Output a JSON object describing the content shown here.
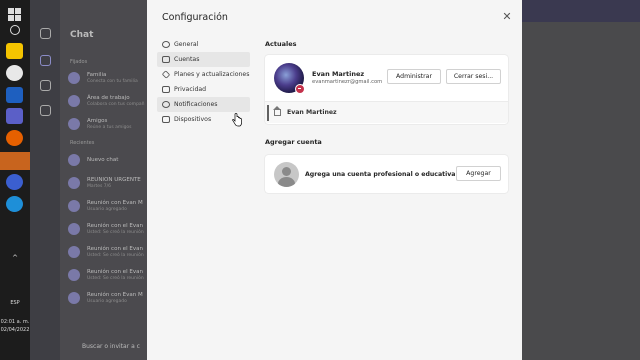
{
  "taskbar": {
    "icons": [
      {
        "name": "windows-start-icon"
      },
      {
        "name": "search-icon"
      },
      {
        "name": "sticky-notes-icon",
        "color": "#f5c400"
      },
      {
        "name": "paint-icon",
        "color": "#e8e8e8"
      },
      {
        "name": "mail-icon",
        "color": "#1e5fbf"
      },
      {
        "name": "teams-icon",
        "color": "#5b5fc7"
      },
      {
        "name": "firefox-icon",
        "color": "#e66000"
      },
      {
        "name": "chrome-icon",
        "color": "#ea4335"
      },
      {
        "name": "app-icon",
        "color": "#c8641e"
      },
      {
        "name": "chromium-icon",
        "color": "#3b5fd0"
      },
      {
        "name": "edge-icon",
        "color": "#1e8fd8"
      }
    ],
    "language": "ESP",
    "time": "02:01 a. m.",
    "date": "02/04/2022"
  },
  "background": {
    "chat_title": "Chat",
    "pinned_label": "Fijados",
    "recent_label": "Recientes",
    "rows": [
      {
        "name": "Familia",
        "sub": "Conecta con tu familia"
      },
      {
        "name": "Área de trabajo",
        "sub": "Colabora con tus compañ"
      },
      {
        "name": "Amigos",
        "sub": "Reúne a tus amigos"
      },
      {
        "name": "Nuevo chat",
        "sub": ""
      },
      {
        "name": "REUNION URGENTE",
        "sub": "Martes 7/6"
      },
      {
        "name": "Reunión con Evan M",
        "sub": "Usuario agregado"
      },
      {
        "name": "Reunión con el Evan",
        "sub": "Usted: Se creó la reunión"
      },
      {
        "name": "Reunión con el Evan",
        "sub": "Usted: Se creó la reunión"
      },
      {
        "name": "Reunión con el Evan",
        "sub": "Usted: Se creó la reunión"
      },
      {
        "name": "Reunión con Evan M",
        "sub": "Usuario agregado"
      }
    ],
    "search_placeholder": "Buscar o invitar a c"
  },
  "modal": {
    "title": "Configuración",
    "close_icon": "close-icon",
    "nav": [
      {
        "label": "General",
        "icon": "gear-icon",
        "active": false
      },
      {
        "label": "Cuentas",
        "icon": "id-card-icon",
        "active": true
      },
      {
        "label": "Planes y actualizaciones",
        "icon": "diamond-icon",
        "active": false
      },
      {
        "label": "Privacidad",
        "icon": "lock-icon",
        "active": false
      },
      {
        "label": "Notificaciones",
        "icon": "bell-icon",
        "active": false
      },
      {
        "label": "Dispositivos",
        "icon": "device-icon",
        "active": false
      }
    ],
    "current_label": "Actuales",
    "account": {
      "name": "Evan Martinez",
      "email": "evanmartinezr@gmail.com",
      "manage_label": "Administrar",
      "signout_label": "Cerrar sesi...",
      "tenant_name": "Evan Martinez",
      "status_color": "#c4314b"
    },
    "add_label": "Agregar cuenta",
    "add_card": {
      "text": "Agrega una cuenta profesional o educativa",
      "button_label": "Agregar"
    }
  }
}
